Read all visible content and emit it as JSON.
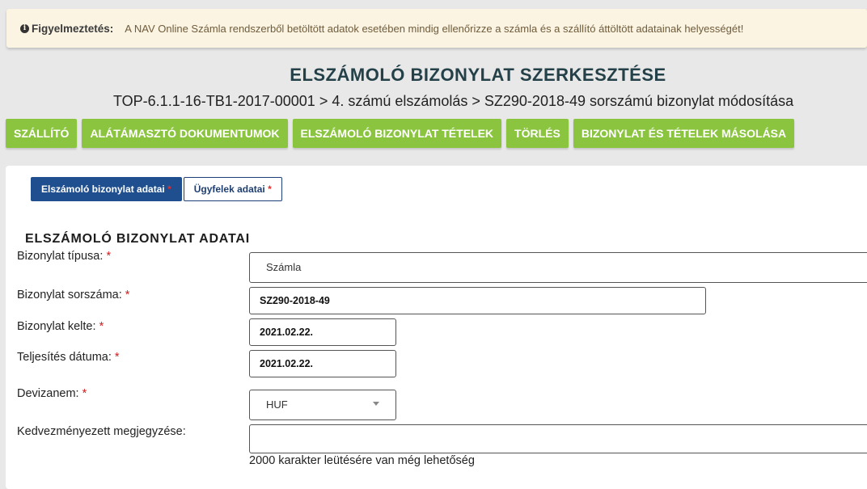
{
  "warning": {
    "icon": "info-icon",
    "label": "Figyelmeztetés:",
    "text": "A NAV Online Számla rendszerből betöltött adatok esetében mindig ellenőrizze a számla és a szállító áttöltött adatainak helyességét!"
  },
  "page": {
    "title": "ELSZÁMOLÓ BIZONYLAT SZERKESZTÉSE",
    "breadcrumb": "TOP-6.1.1-16-TB1-2017-00001 > 4. számú elszámolás > SZ290-2018-49 sorszámú bizonylat módosítása"
  },
  "actions": {
    "supplier": "SZÁLLÍTÓ",
    "supporting_docs": "ALÁTÁMASZTÓ DOKUMENTUMOK",
    "items": "ELSZÁMOLÓ BIZONYLAT TÉTELEK",
    "delete": "TÖRLÉS",
    "copy": "BIZONYLAT ÉS TÉTELEK MÁSOLÁSA"
  },
  "tabs": {
    "voucher_data": "Elszámoló bizonylat adatai",
    "client_data": "Ügyfelek adatai",
    "required_mark": "*"
  },
  "form": {
    "section_title": "ELSZÁMOLÓ BIZONYLAT ADATAI",
    "required_mark": "*",
    "type_label": "Bizonylat típusa:",
    "type_value": "Számla",
    "number_label": "Bizonylat sorszáma:",
    "number_value": "SZ290-2018-49",
    "issue_date_label": "Bizonylat kelte:",
    "issue_date_value": "2021.02.22.",
    "fulfillment_label": "Teljesítés dátuma:",
    "fulfillment_value": "2021.02.22.",
    "currency_label": "Devizanem:",
    "currency_value": "HUF",
    "beneficiary_label": "Kedvezményezett megjegyzése:",
    "beneficiary_value": "",
    "remaining_chars": "2000 karakter leütésére van még lehetőség"
  }
}
